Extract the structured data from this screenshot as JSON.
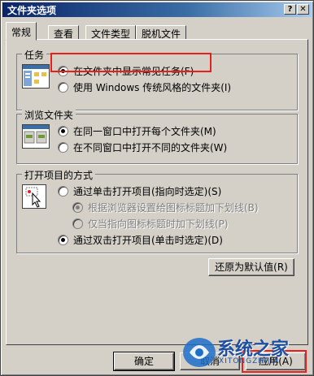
{
  "window": {
    "title": "文件夹选项",
    "help_label": "?",
    "close_label": "✕"
  },
  "tabs": [
    {
      "label": "常规",
      "active": true
    },
    {
      "label": "查看",
      "active": false
    },
    {
      "label": "文件类型",
      "active": false
    },
    {
      "label": "脱机文件",
      "active": false
    }
  ],
  "tasks_group": {
    "title": "任务",
    "options": [
      {
        "label": "在文件夹中显示常见任务(F)",
        "checked": true
      },
      {
        "label": "使用 Windows 传统风格的文件夹(I)",
        "checked": false
      }
    ]
  },
  "browse_group": {
    "title": "浏览文件夹",
    "options": [
      {
        "label": "在同一窗口中打开每个文件夹(M)",
        "checked": true
      },
      {
        "label": "在不同窗口中打开不同的文件夹(W)",
        "checked": false
      }
    ]
  },
  "open_group": {
    "title": "打开项目的方式",
    "options": [
      {
        "label": "通过单击打开项目(指向时选定)(S)",
        "checked": false
      },
      {
        "label": "根据浏览器设置给图标标题加下划线(B)",
        "checked": true,
        "disabled": true
      },
      {
        "label": "仅当指向图标标题时加下划线(P)",
        "checked": false,
        "disabled": true
      },
      {
        "label": "通过双击打开项目(单击时选定)(D)",
        "checked": true
      }
    ]
  },
  "restore_defaults_label": "还原为默认值(R)",
  "footer": {
    "ok_label": "确定",
    "cancel_label": "取消",
    "apply_label": "应用(A)"
  },
  "watermark": {
    "brand": "系统之家",
    "sub": "XITONGZHIJIA"
  },
  "colors": {
    "highlight": "#e8201b",
    "titlebar": "#0a246a",
    "face": "#d4d0c8"
  }
}
